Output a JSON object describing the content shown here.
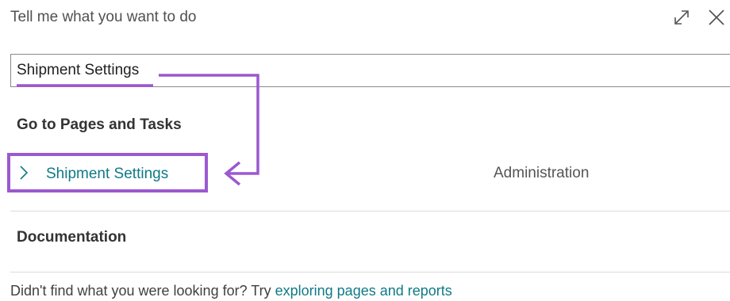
{
  "dialog": {
    "title": "Tell me what you want to do",
    "expand_icon": "expand-icon",
    "close_icon": "close-icon"
  },
  "search": {
    "value": "Shipment Settings"
  },
  "sections": {
    "pages_and_tasks": {
      "heading": "Go to Pages and Tasks",
      "results": [
        {
          "label": "Shipment Settings",
          "category": "Administration",
          "icon": "chevron-right-icon"
        }
      ]
    },
    "documentation": {
      "heading": "Documentation"
    }
  },
  "footer": {
    "prefix": "Didn't find what you were looking for? Try",
    "link": "exploring pages and reports"
  },
  "colors": {
    "link": "#0f7a86",
    "annotation": "#9b59d0",
    "border": "#8a8a8a"
  }
}
